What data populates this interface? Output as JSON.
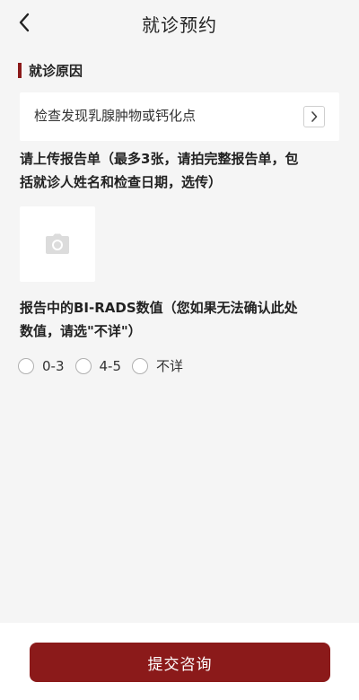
{
  "header": {
    "title": "就诊预约",
    "back_icon": "chevron-left-icon"
  },
  "section": {
    "title": "就诊原因"
  },
  "reason": {
    "value": "检查发现乳腺肿物或钙化点",
    "arrow_icon": "chevron-right-icon"
  },
  "upload": {
    "question_line1": "请上传报告单（最多3张，请拍完整报告单，包",
    "question_line2": "括就诊人姓名和检查日期，选传）",
    "camera_icon": "camera-icon"
  },
  "birads": {
    "question_line1": "报告中的BI-RADS数值（您如果无法确认此处",
    "question_line2": "数值，请选\"不详\"）",
    "options": [
      "0-3",
      "4-5",
      "不详"
    ]
  },
  "footer": {
    "submit_label": "提交咨询"
  },
  "colors": {
    "accent": "#8b1a1a",
    "background": "#f5f5f5"
  }
}
